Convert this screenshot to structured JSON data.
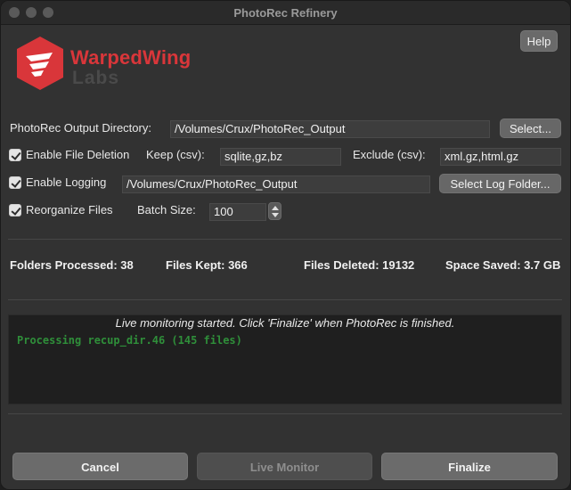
{
  "window": {
    "title": "PhotoRec Refinery"
  },
  "header": {
    "help_label": "Help"
  },
  "logo": {
    "brand": "WarpedWing",
    "sub": "Labs",
    "brand_color": "#d9363a"
  },
  "output_dir": {
    "label": "PhotoRec Output Directory:",
    "value": "/Volumes/Crux/PhotoRec_Output",
    "button": "Select..."
  },
  "deletion": {
    "label": "Enable File Deletion",
    "checked": true,
    "keep_label": "Keep (csv):",
    "keep_value": "sqlite,gz,bz",
    "exclude_label": "Exclude (csv):",
    "exclude_value": "xml.gz,html.gz"
  },
  "logging": {
    "label": "Enable Logging",
    "checked": true,
    "value": "/Volumes/Crux/PhotoRec_Output",
    "button": "Select Log Folder..."
  },
  "reorganize": {
    "label": "Reorganize Files",
    "checked": true,
    "batch_label": "Batch Size:",
    "batch_value": "100"
  },
  "stats": {
    "folders": "Folders Processed: 38",
    "kept": "Files Kept: 366",
    "deleted": "Files Deleted: 19132",
    "saved": "Space Saved: 3.7 GB"
  },
  "monitor": {
    "header": "Live monitoring started. Click 'Finalize' when PhotoRec is finished.",
    "line": "Processing recup_dir.46 (145 files)",
    "line_color": "#2f8f3a"
  },
  "footer": {
    "cancel": "Cancel",
    "live_monitor": "Live Monitor",
    "finalize": "Finalize"
  }
}
